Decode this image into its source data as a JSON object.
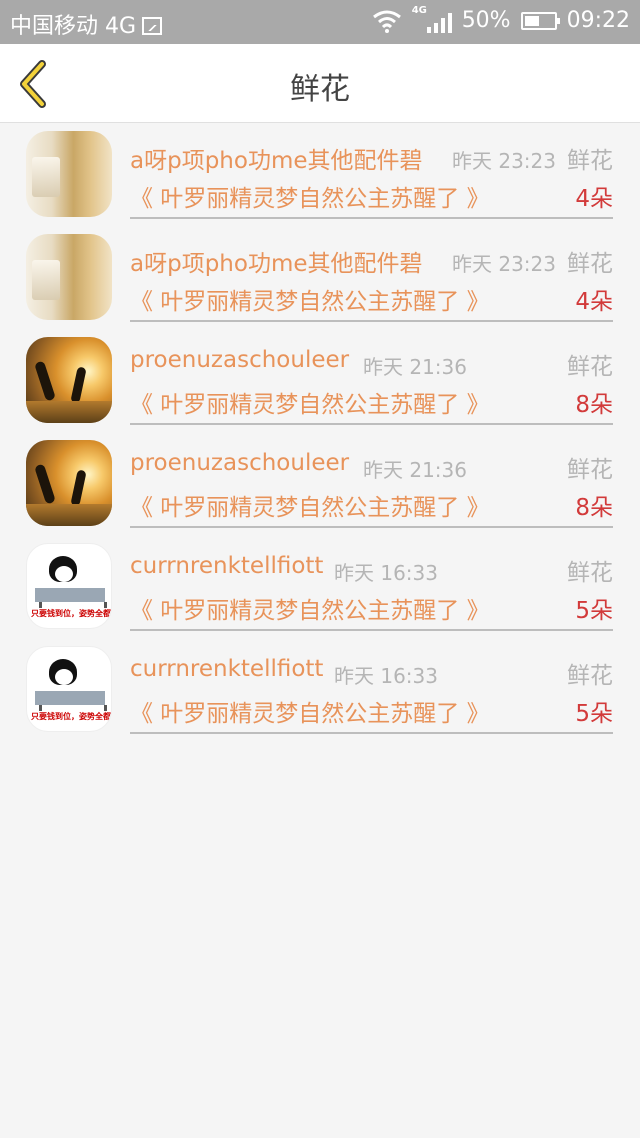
{
  "status_bar": {
    "carrier": "中国移动 4G",
    "network_tag": "4G",
    "battery": "50%",
    "time": "09:22"
  },
  "header": {
    "title": "鲜花"
  },
  "rows": [
    {
      "name": "a呀p项pho功me其他配件碧",
      "time": "昨天 23:23",
      "gift": "鲜花",
      "book": "《 叶罗丽精灵梦自然公主苏醒了 》",
      "count": "4朵"
    },
    {
      "name": "a呀p项pho功me其他配件碧",
      "time": "昨天 23:23",
      "gift": "鲜花",
      "book": "《 叶罗丽精灵梦自然公主苏醒了 》",
      "count": "4朵"
    },
    {
      "name": "proenuzaschouleer",
      "time": "昨天 21:36",
      "gift": "鲜花",
      "book": "《 叶罗丽精灵梦自然公主苏醒了 》",
      "count": "8朵"
    },
    {
      "name": "proenuzaschouleer",
      "time": "昨天 21:36",
      "gift": "鲜花",
      "book": "《 叶罗丽精灵梦自然公主苏醒了 》",
      "count": "8朵"
    },
    {
      "name": "currnrenktellfiott",
      "time": "昨天 16:33",
      "gift": "鲜花",
      "book": "《 叶罗丽精灵梦自然公主苏醒了 》",
      "count": "5朵"
    },
    {
      "name": "currnrenktellfiott",
      "time": "昨天 16:33",
      "gift": "鲜花",
      "book": "《 叶罗丽精灵梦自然公主苏醒了 》",
      "count": "5朵"
    }
  ],
  "avatar_caption": "只要钱到位，姿势全都会!"
}
